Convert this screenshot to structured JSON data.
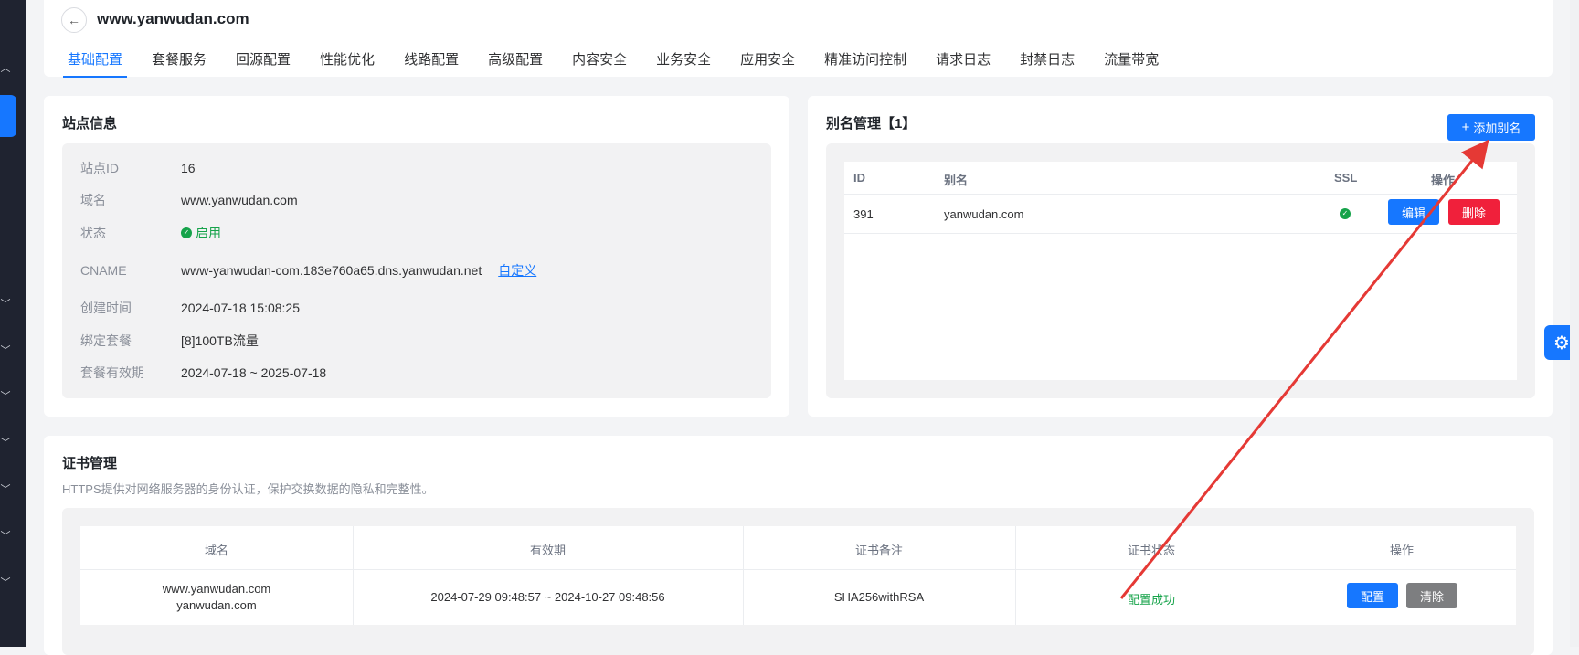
{
  "header": {
    "site_name": "www.yanwudan.com",
    "tabs": [
      "基础配置",
      "套餐服务",
      "回源配置",
      "性能优化",
      "线路配置",
      "高级配置",
      "内容安全",
      "业务安全",
      "应用安全",
      "精准访问控制",
      "请求日志",
      "封禁日志",
      "流量带宽"
    ],
    "active_tab": "基础配置"
  },
  "site_info": {
    "title": "站点信息",
    "rows": [
      {
        "label": "站点ID",
        "value": "16"
      },
      {
        "label": "域名",
        "value": "www.yanwudan.com"
      },
      {
        "label": "状态",
        "value": "启用"
      },
      {
        "label": "CNAME",
        "value": "www-yanwudan-com.183e760a65.dns.yanwudan.net"
      },
      {
        "label": "创建时间",
        "value": "2024-07-18 15:08:25"
      },
      {
        "label": "绑定套餐",
        "value": "[8]100TB流量"
      },
      {
        "label": "套餐有效期",
        "value": "2024-07-18 ~ 2025-07-18"
      }
    ],
    "cname_link": "自定义"
  },
  "alias": {
    "title": "别名管理【1】",
    "add_button": "添加别名",
    "columns": [
      "ID",
      "别名",
      "SSL",
      "操作"
    ],
    "rows": [
      {
        "id": "391",
        "alias": "yanwudan.com",
        "edit": "编辑",
        "delete": "删除"
      }
    ]
  },
  "cert": {
    "title": "证书管理",
    "description": "HTTPS提供对网络服务器的身份认证，保护交换数据的隐私和完整性。",
    "columns": [
      "域名",
      "有效期",
      "证书备注",
      "证书状态",
      "操作"
    ],
    "row": {
      "domain1": "www.yanwudan.com",
      "domain2": "yanwudan.com",
      "validity": "2024-07-29 09:48:57 ~ 2024-10-27 09:48:56",
      "note": "SHA256withRSA",
      "status": "配置成功",
      "config": "配置",
      "clear": "清除"
    }
  },
  "colors": {
    "accent": "#1677ff",
    "success": "#16a34a",
    "danger": "#f0203b",
    "annotation": "#e53935"
  }
}
